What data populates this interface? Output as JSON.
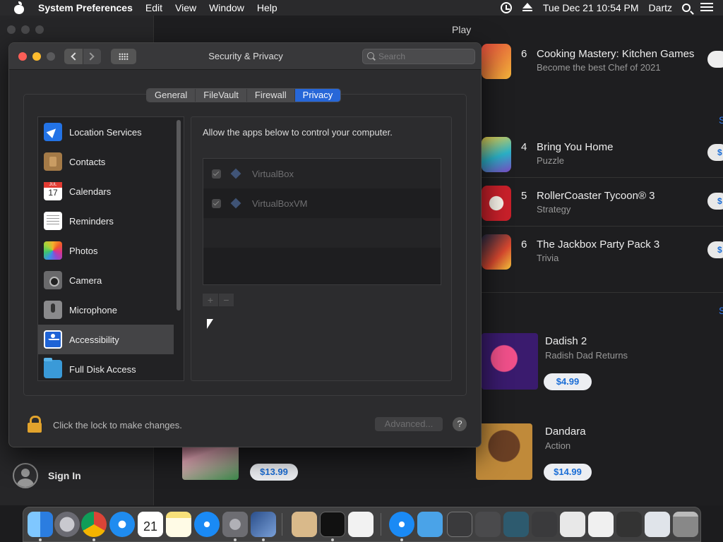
{
  "menubar": {
    "app": "System Preferences",
    "items": [
      "Edit",
      "View",
      "Window",
      "Help"
    ],
    "clock": "Tue Dec 21  10:54 PM",
    "user": "Dartz"
  },
  "appstore": {
    "title": "Play",
    "rows": [
      {
        "num": "6",
        "name": "Cooking Mastery: Kitchen Games",
        "sub": "Become the best Chef of 2021"
      },
      {
        "num": "4",
        "name": "Bring You Home",
        "sub": "Puzzle",
        "btn": "$"
      },
      {
        "num": "5",
        "name": "RollerCoaster Tycoon® 3",
        "sub": "Strategy",
        "btn": "$"
      },
      {
        "num": "6",
        "name": "The Jackbox Party Pack 3",
        "sub": "Trivia",
        "btn": "$"
      }
    ],
    "see_all_1": "S",
    "see_all_2": "S",
    "featured": [
      {
        "name": "Dadish 2",
        "sub": "Radish Dad Returns",
        "price": "$4.99"
      },
      {
        "name": "Dandara",
        "sub": "Action",
        "price": "$14.99"
      },
      {
        "name": "",
        "sub": "",
        "price": "$13.99"
      }
    ],
    "sign_in": "Sign In"
  },
  "window": {
    "title": "Security & Privacy",
    "search_placeholder": "Search",
    "tabs": [
      "General",
      "FileVault",
      "Firewall",
      "Privacy"
    ],
    "active_tab": "Privacy",
    "categories": [
      {
        "label": "Location Services",
        "icon": "location-icon"
      },
      {
        "label": "Contacts",
        "icon": "contacts-icon"
      },
      {
        "label": "Calendars",
        "icon": "calendar-icon"
      },
      {
        "label": "Reminders",
        "icon": "reminders-icon"
      },
      {
        "label": "Photos",
        "icon": "photos-icon"
      },
      {
        "label": "Camera",
        "icon": "camera-icon"
      },
      {
        "label": "Microphone",
        "icon": "microphone-icon"
      },
      {
        "label": "Accessibility",
        "icon": "accessibility-icon"
      },
      {
        "label": "Full Disk Access",
        "icon": "folder-icon"
      }
    ],
    "selected_category": "Accessibility",
    "allow_text": "Allow the apps below to control your computer.",
    "apps": [
      {
        "name": "VirtualBox",
        "checked": true
      },
      {
        "name": "VirtualBoxVM",
        "checked": true
      }
    ],
    "add": "+",
    "remove": "−",
    "lock_text": "Click the lock to make changes.",
    "advanced": "Advanced...",
    "help": "?"
  },
  "calendar_day": "21",
  "colors": {
    "accent": "#2767d8",
    "lock": "#e2a32c"
  }
}
